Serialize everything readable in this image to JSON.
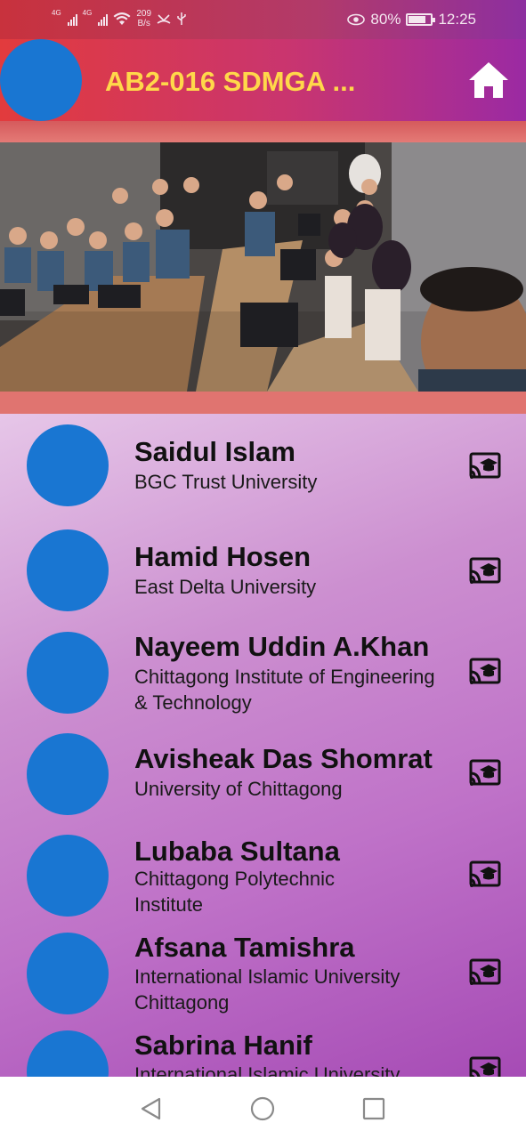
{
  "status_bar": {
    "network_1": "4G",
    "network_2": "4G",
    "data_speed": "209",
    "data_speed_unit": "B/s",
    "battery": "80%",
    "time": "12:25",
    "battery_level": 0.8
  },
  "app_bar": {
    "title": "AB2-016 SDMGA ...",
    "home_icon": "home-icon"
  },
  "hero_image": {
    "description_icon": "group-photo"
  },
  "students": [
    {
      "name": "Saidul Islam",
      "institution": "BGC Trust University"
    },
    {
      "name": "Hamid Hosen",
      "institution": "East Delta University"
    },
    {
      "name": "Nayeem Uddin A.Khan",
      "institution": "Chittagong Institute of Engineering & Technology"
    },
    {
      "name": "Avisheak Das Shomrat",
      "institution": "University of Chittagong"
    },
    {
      "name": "Lubaba Sultana",
      "institution": "Chittagong Polytechnic Institute"
    },
    {
      "name": "Afsana Tamishra",
      "institution": "International Islamic University Chittagong"
    },
    {
      "name": "Sabrina Hanif",
      "institution": "International Islamic University"
    }
  ],
  "row_icon": "cast-for-education-icon",
  "nav_bar": {
    "back_icon": "back-triangle-icon",
    "home_icon": "home-circle-icon",
    "recents_icon": "recents-square-icon"
  },
  "colors": {
    "accent": "#1976d2",
    "title": "#ffd84a",
    "appbar_start": "#e23b3d",
    "appbar_end": "#9b2aa3"
  }
}
